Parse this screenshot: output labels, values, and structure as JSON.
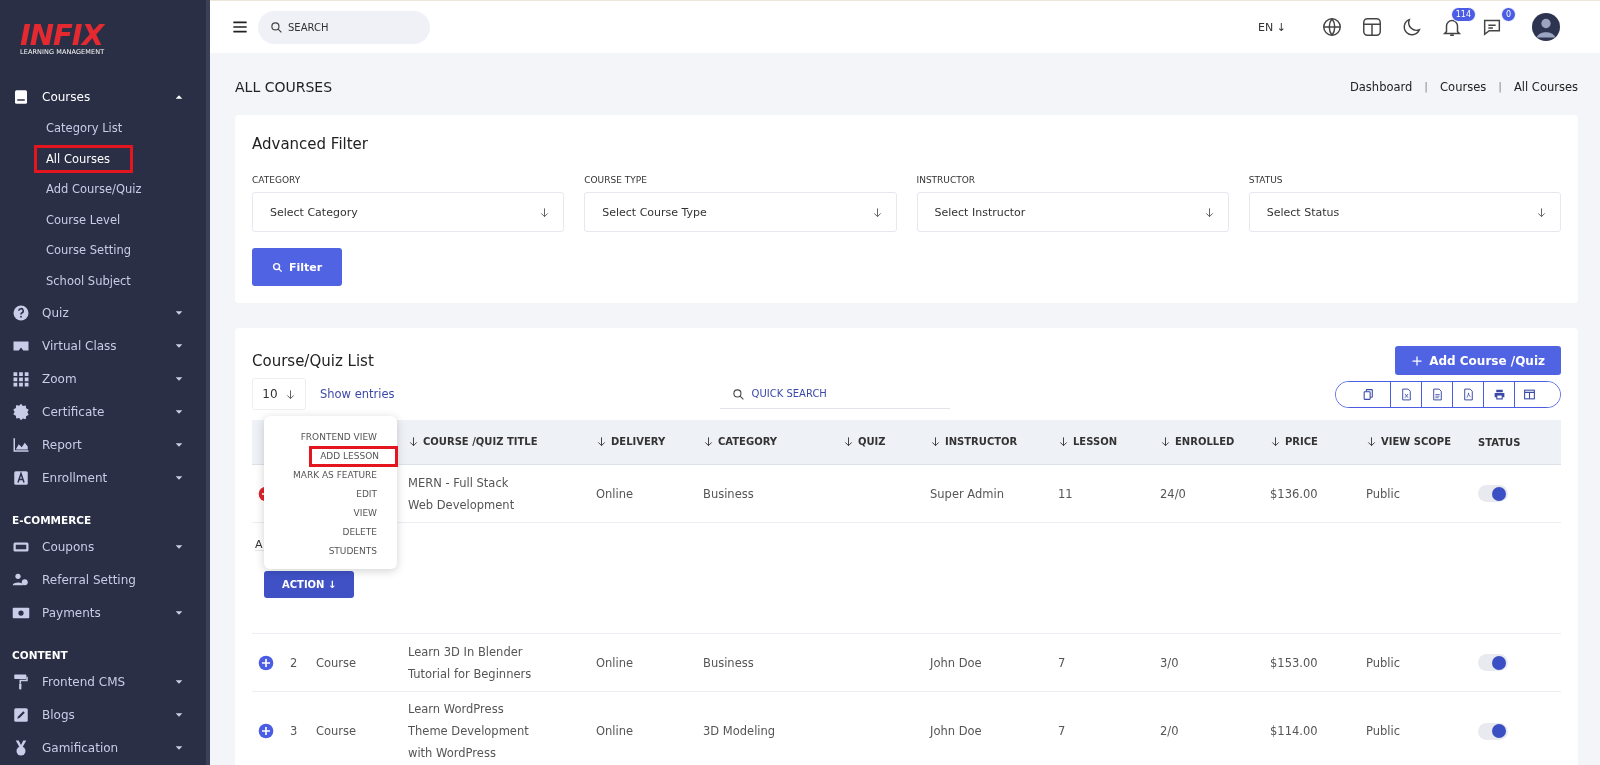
{
  "logo": {
    "brand": "INFIX",
    "tagline": "LEARNING MANAGEMENT"
  },
  "sidebar": {
    "sections": [
      {
        "items": [
          {
            "label": "Courses",
            "kind": "menu",
            "expanded": true,
            "children": [
              {
                "label": "Category List",
                "selected": false
              },
              {
                "label": "All Courses",
                "selected": true,
                "highlighted": true
              },
              {
                "label": "Add Course/Quiz",
                "selected": false
              },
              {
                "label": "Course Level",
                "selected": false
              },
              {
                "label": "Course Setting",
                "selected": false
              },
              {
                "label": "School Subject",
                "selected": false
              }
            ]
          },
          {
            "label": "Quiz",
            "kind": "menu",
            "expanded": false
          },
          {
            "label": "Virtual Class",
            "kind": "menu",
            "expanded": false
          },
          {
            "label": "Zoom",
            "kind": "menu",
            "expanded": false
          },
          {
            "label": "Certificate",
            "kind": "menu",
            "expanded": false
          },
          {
            "label": "Report",
            "kind": "menu",
            "expanded": false
          },
          {
            "label": "Enrollment",
            "kind": "menu",
            "expanded": false
          }
        ]
      },
      {
        "heading": "E-COMMERCE",
        "items": [
          {
            "label": "Coupons",
            "kind": "menu",
            "expanded": false
          },
          {
            "label": "Referral Setting",
            "kind": "link"
          },
          {
            "label": "Payments",
            "kind": "menu",
            "expanded": false
          }
        ]
      },
      {
        "heading": "CONTENT",
        "items": [
          {
            "label": "Frontend CMS",
            "kind": "menu",
            "expanded": false
          },
          {
            "label": "Blogs",
            "kind": "menu",
            "expanded": false
          },
          {
            "label": "Gamification",
            "kind": "menu",
            "expanded": false
          }
        ]
      }
    ]
  },
  "topbar": {
    "search": {
      "placeholder": "SEARCH"
    },
    "language": "EN ↓",
    "notifications": "114",
    "messages": "0"
  },
  "page": {
    "title": "ALL COURSES",
    "breadcrumb": [
      {
        "kind": "link",
        "text": "Dashboard"
      },
      {
        "kind": "separator",
        "text": "|"
      },
      {
        "kind": "link",
        "text": "Courses"
      },
      {
        "kind": "separator",
        "text": "|"
      },
      {
        "kind": "link",
        "text": "All Courses"
      }
    ]
  },
  "filter": {
    "title": "Advanced Filter",
    "fields": [
      {
        "label": "CATEGORY",
        "placeholder": "Select Category"
      },
      {
        "label": "COURSE TYPE",
        "placeholder": "Select Course Type"
      },
      {
        "label": "INSTRUCTOR",
        "placeholder": "Select Instructor"
      },
      {
        "label": "STATUS",
        "placeholder": "Select Status"
      }
    ],
    "button": "Filter"
  },
  "list": {
    "title": "Course/Quiz List",
    "add_button": "Add Course /Quiz",
    "page_size": "10",
    "show_entries": "Show entries",
    "quick_search": {
      "placeholder": "QUICK SEARCH"
    },
    "columns": [
      "",
      "",
      "",
      "COURSE /QUIZ TITLE",
      "DELIVERY",
      "CATEGORY",
      "QUIZ",
      "INSTRUCTOR",
      "LESSON",
      "ENROLLED",
      "PRICE",
      "VIEW SCOPE",
      "STATUS"
    ],
    "rows": [
      {
        "expanded": true,
        "number": "",
        "type": "",
        "title": "MERN - Full Stack Web Development",
        "delivery": "Online",
        "category": "Business",
        "quiz": "",
        "instructor": "Super Admin",
        "lesson": "11",
        "enrolled": "24/0",
        "price": "$136.00",
        "view_scope": "Public",
        "status_on": true,
        "details": {
          "label": "A",
          "action_button": "ACTION ↓",
          "menu": [
            {
              "label": "FRONTEND VIEW",
              "highlighted": false
            },
            {
              "label": "ADD LESSON",
              "highlighted": true
            },
            {
              "label": "MARK AS FEATURE",
              "highlighted": false
            },
            {
              "label": "EDIT",
              "highlighted": false
            },
            {
              "label": "VIEW",
              "highlighted": false
            },
            {
              "label": "DELETE",
              "highlighted": false
            },
            {
              "label": "STUDENTS",
              "highlighted": false
            }
          ]
        }
      },
      {
        "expanded": false,
        "number": "2",
        "type": "Course",
        "title": "Learn 3D In Blender Tutorial for Beginners",
        "delivery": "Online",
        "category": "Business",
        "quiz": "",
        "instructor": "John Doe",
        "lesson": "7",
        "enrolled": "3/0",
        "price": "$153.00",
        "view_scope": "Public",
        "status_on": true
      },
      {
        "expanded": false,
        "number": "3",
        "type": "Course",
        "title": "Learn WordPress Theme Development with WordPress",
        "delivery": "Online",
        "category": "3D Modeling",
        "quiz": "",
        "instructor": "John Doe",
        "lesson": "7",
        "enrolled": "2/0",
        "price": "$114.00",
        "view_scope": "Public",
        "status_on": true
      }
    ]
  }
}
